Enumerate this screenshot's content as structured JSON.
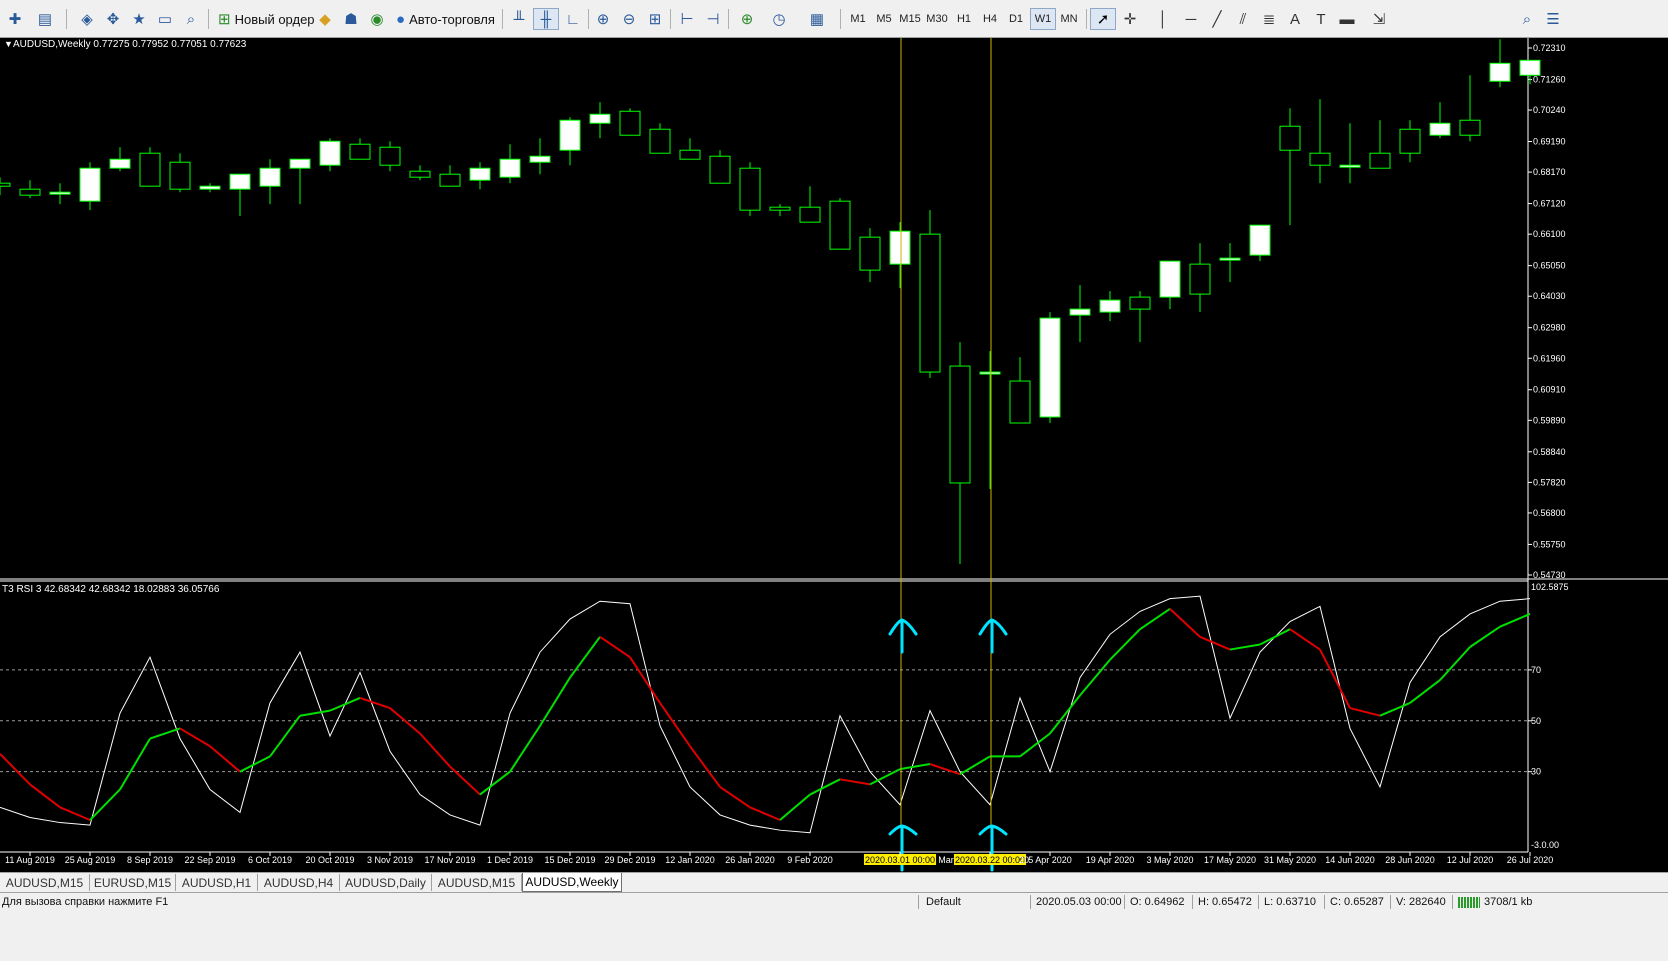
{
  "toolbar": {
    "new_order_label": "Новый ордер",
    "auto_trading_label": "Авто-торговля",
    "timeframes": [
      "M1",
      "M5",
      "M15",
      "M30",
      "H1",
      "H4",
      "D1",
      "W1",
      "MN"
    ],
    "active_timeframe": "W1"
  },
  "main_chart": {
    "header": "AUDUSD,Weekly  0.77275 0.77952 0.77051 0.77623",
    "price_labels": [
      "0.72310",
      "0.71260",
      "0.70240",
      "0.69190",
      "0.68170",
      "0.67120",
      "0.66100",
      "0.65050",
      "0.64030",
      "0.62980",
      "0.61960",
      "0.60910",
      "0.59890",
      "0.58840",
      "0.57820",
      "0.56800",
      "0.55750",
      "0.54730"
    ]
  },
  "indicator": {
    "header": "T3 RSI 3 42.68342 42.68342 18.02883 36.05766",
    "scale_top": "102.5875",
    "levels": [
      "70",
      "50",
      "30"
    ],
    "scale_bottom": "-3.0.00"
  },
  "time_axis": {
    "labels": [
      "11 Aug 2019",
      "25 Aug 2019",
      "8 Sep 2019",
      "22 Sep 2019",
      "6 Oct 2019",
      "20 Oct 2019",
      "3 Nov 2019",
      "17 Nov 2019",
      "1 Dec 2019",
      "15 Dec 2019",
      "29 Dec 2019",
      "12 Jan 2020",
      "26 Jan 2020",
      "9 Feb 2020",
      "2020.03.01 00:00",
      "2020.03.22 00:00",
      "5 Apr 2020",
      "19 Apr 2020",
      "3 May 2020",
      "17 May 2020",
      "31 May 2020",
      "14 Jun 2020",
      "28 Jun 2020",
      "12 Jul 2020",
      "26 Jul 2020"
    ],
    "mar_fragment": "Mar",
    "fragment_20": "20"
  },
  "tabs": [
    "AUDUSD,M15",
    "EURUSD,M15",
    "AUDUSD,H1",
    "AUDUSD,H4",
    "AUDUSD,Daily",
    "AUDUSD,M15",
    "AUDUSD,Weekly"
  ],
  "active_tab": "AUDUSD,Weekly",
  "status": {
    "help": "Для вызова справки нажмите F1",
    "profile": "Default",
    "datetime": "2020.05.03 00:00",
    "open": "O: 0.64962",
    "high": "H: 0.65472",
    "low": "L: 0.63710",
    "close": "C: 0.65287",
    "volume": "V: 282640",
    "traffic": "3708/1 kb"
  },
  "colors": {
    "bull_candle": "#ffffff",
    "bear_candle": "#000000",
    "candle_wick": "#00ff00",
    "rsi_fast": "#ffffff",
    "rsi_signal_up": "#00e000",
    "rsi_signal_down": "#e00000",
    "marker_lines": "#c8b400",
    "arrows": "#00e5ff"
  },
  "chart_data": [
    {
      "type": "candlestick",
      "title": "AUDUSD,Weekly",
      "x": [
        "2019-08-04",
        "2019-08-11",
        "2019-08-18",
        "2019-08-25",
        "2019-09-01",
        "2019-09-08",
        "2019-09-15",
        "2019-09-22",
        "2019-09-29",
        "2019-10-06",
        "2019-10-13",
        "2019-10-20",
        "2019-10-27",
        "2019-11-03",
        "2019-11-10",
        "2019-11-17",
        "2019-11-24",
        "2019-12-01",
        "2019-12-08",
        "2019-12-15",
        "2019-12-22",
        "2019-12-29",
        "2020-01-05",
        "2020-01-12",
        "2020-01-19",
        "2020-01-26",
        "2020-02-02",
        "2020-02-09",
        "2020-02-16",
        "2020-02-23",
        "2020-03-01",
        "2020-03-08",
        "2020-03-15",
        "2020-03-22",
        "2020-03-29",
        "2020-04-05",
        "2020-04-12",
        "2020-04-19",
        "2020-04-26",
        "2020-05-03",
        "2020-05-10",
        "2020-05-17",
        "2020-05-24",
        "2020-05-31",
        "2020-06-07",
        "2020-06-14",
        "2020-06-21",
        "2020-06-28",
        "2020-07-05",
        "2020-07-12",
        "2020-07-19",
        "2020-07-26"
      ],
      "open": [
        0.678,
        0.676,
        0.675,
        0.672,
        0.683,
        0.688,
        0.685,
        0.676,
        0.676,
        0.677,
        0.683,
        0.684,
        0.691,
        0.69,
        0.682,
        0.681,
        0.679,
        0.68,
        0.685,
        0.689,
        0.698,
        0.702,
        0.696,
        0.689,
        0.687,
        0.683,
        0.67,
        0.67,
        0.672,
        0.66,
        0.651,
        0.661,
        0.617,
        0.615,
        0.612,
        0.6,
        0.634,
        0.635,
        0.64,
        0.64,
        0.651,
        0.653,
        0.654,
        0.697,
        0.688,
        0.684,
        0.688,
        0.696,
        0.694,
        0.699,
        0.712,
        0.714
      ],
      "high": [
        0.68,
        0.679,
        0.678,
        0.685,
        0.69,
        0.69,
        0.688,
        0.678,
        0.679,
        0.686,
        0.686,
        0.693,
        0.693,
        0.692,
        0.684,
        0.684,
        0.685,
        0.691,
        0.693,
        0.7,
        0.705,
        0.703,
        0.698,
        0.693,
        0.689,
        0.685,
        0.671,
        0.677,
        0.673,
        0.663,
        0.665,
        0.669,
        0.625,
        0.622,
        0.62,
        0.635,
        0.644,
        0.642,
        0.642,
        0.65,
        0.658,
        0.658,
        0.663,
        0.703,
        0.706,
        0.698,
        0.699,
        0.699,
        0.705,
        0.714,
        0.726,
        0.718
      ],
      "low": [
        0.674,
        0.673,
        0.671,
        0.669,
        0.682,
        0.68,
        0.675,
        0.675,
        0.667,
        0.671,
        0.671,
        0.682,
        0.688,
        0.682,
        0.679,
        0.679,
        0.676,
        0.678,
        0.681,
        0.684,
        0.693,
        0.694,
        0.693,
        0.687,
        0.683,
        0.667,
        0.667,
        0.669,
        0.661,
        0.645,
        0.643,
        0.613,
        0.551,
        0.576,
        0.599,
        0.598,
        0.625,
        0.632,
        0.625,
        0.636,
        0.635,
        0.645,
        0.652,
        0.664,
        0.678,
        0.678,
        0.683,
        0.685,
        0.693,
        0.692,
        0.71,
        0.711
      ],
      "close": [
        0.677,
        0.674,
        0.675,
        0.683,
        0.686,
        0.677,
        0.676,
        0.677,
        0.681,
        0.683,
        0.686,
        0.692,
        0.686,
        0.684,
        0.68,
        0.677,
        0.683,
        0.686,
        0.687,
        0.699,
        0.701,
        0.694,
        0.688,
        0.686,
        0.678,
        0.669,
        0.669,
        0.665,
        0.656,
        0.649,
        0.662,
        0.615,
        0.578,
        0.615,
        0.598,
        0.633,
        0.636,
        0.639,
        0.636,
        0.652,
        0.641,
        0.653,
        0.664,
        0.689,
        0.684,
        0.684,
        0.683,
        0.688,
        0.698,
        0.694,
        0.718,
        0.719
      ]
    },
    {
      "type": "line",
      "title": "T3 RSI 3 42.68342 42.68342 18.02883 36.05766",
      "x": [
        "2019-08-04",
        "2019-08-11",
        "2019-08-18",
        "2019-08-25",
        "2019-09-01",
        "2019-09-08",
        "2019-09-15",
        "2019-09-22",
        "2019-09-29",
        "2019-10-06",
        "2019-10-13",
        "2019-10-20",
        "2019-10-27",
        "2019-11-03",
        "2019-11-10",
        "2019-11-17",
        "2019-11-24",
        "2019-12-01",
        "2019-12-08",
        "2019-12-15",
        "2019-12-22",
        "2019-12-29",
        "2020-01-05",
        "2020-01-12",
        "2020-01-19",
        "2020-01-26",
        "2020-02-02",
        "2020-02-09",
        "2020-02-16",
        "2020-02-23",
        "2020-03-01",
        "2020-03-08",
        "2020-03-15",
        "2020-03-22",
        "2020-03-29",
        "2020-04-05",
        "2020-04-12",
        "2020-04-19",
        "2020-04-26",
        "2020-05-03",
        "2020-05-10",
        "2020-05-17",
        "2020-05-24",
        "2020-05-31",
        "2020-06-07",
        "2020-06-14",
        "2020-06-21",
        "2020-06-28",
        "2020-07-05",
        "2020-07-12",
        "2020-07-19",
        "2020-07-26"
      ],
      "ylim": [
        0,
        102.5875
      ],
      "levels": [
        70,
        50,
        30
      ],
      "series": [
        {
          "values": [
            16,
            12,
            10,
            9,
            53,
            75,
            43,
            23,
            14,
            57,
            77,
            44,
            69,
            38,
            21,
            13,
            9,
            53,
            77,
            90,
            97,
            96,
            48,
            24,
            13,
            9,
            7,
            6,
            52,
            30,
            17,
            54,
            30,
            17,
            59,
            30,
            67,
            84,
            93,
            98,
            99,
            51,
            77,
            89,
            95,
            47,
            24,
            65,
            83,
            92,
            97,
            98
          ]
        },
        {
          "values": [
            37,
            25,
            16,
            11,
            23,
            43,
            47,
            40,
            30,
            36,
            52,
            54,
            59,
            55,
            45,
            32,
            21,
            30,
            48,
            67,
            83,
            75,
            57,
            40,
            24,
            16,
            11,
            21,
            27,
            25,
            31,
            33,
            29,
            36,
            36,
            45,
            60,
            74,
            86,
            94,
            83,
            78,
            80,
            86,
            78,
            55,
            52,
            57,
            66,
            79,
            87,
            92
          ]
        }
      ]
    }
  ]
}
